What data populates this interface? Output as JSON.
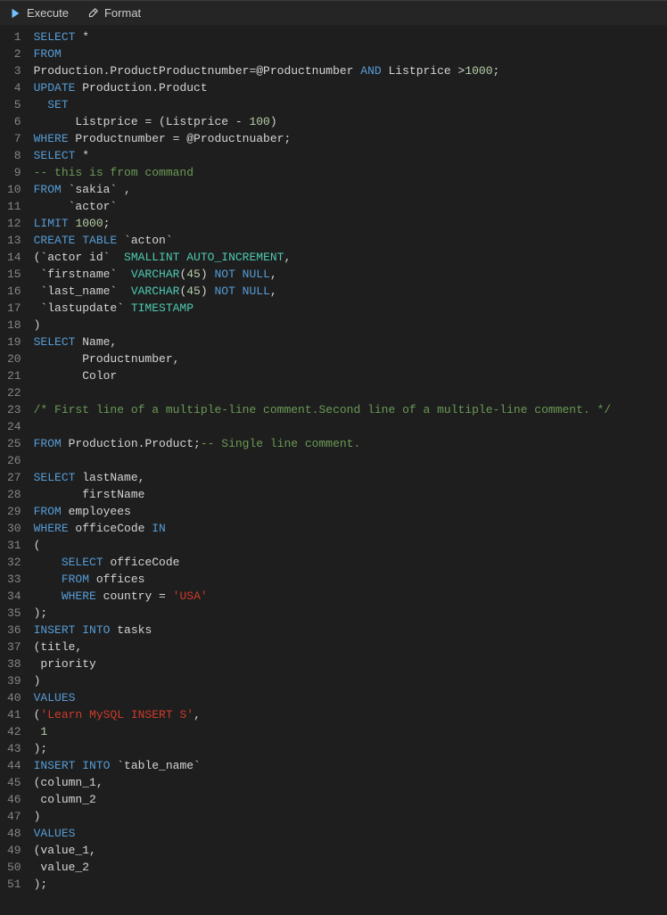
{
  "toolbar": {
    "execute_label": "Execute",
    "format_label": "Format"
  },
  "code": {
    "lines": [
      [
        {
          "c": "kw",
          "t": "SELECT"
        },
        {
          "c": "id",
          "t": " *"
        }
      ],
      [
        {
          "c": "kw",
          "t": "FROM"
        }
      ],
      [
        {
          "c": "id",
          "t": "Production.ProductProductnumber=@Productnumber "
        },
        {
          "c": "kw",
          "t": "AND"
        },
        {
          "c": "id",
          "t": " Listprice >"
        },
        {
          "c": "num",
          "t": "1000"
        },
        {
          "c": "punc",
          "t": ";"
        }
      ],
      [
        {
          "c": "kw",
          "t": "UPDATE"
        },
        {
          "c": "id",
          "t": " Production.Product"
        }
      ],
      [
        {
          "c": "id",
          "t": "  "
        },
        {
          "c": "kw",
          "t": "SET"
        }
      ],
      [
        {
          "c": "id",
          "t": "      Listprice = (Listprice - "
        },
        {
          "c": "num",
          "t": "100"
        },
        {
          "c": "punc",
          "t": ")"
        }
      ],
      [
        {
          "c": "kw",
          "t": "WHERE"
        },
        {
          "c": "id",
          "t": " Productnumber = @Productnuaber;"
        }
      ],
      [
        {
          "c": "kw",
          "t": "SELECT"
        },
        {
          "c": "id",
          "t": " *"
        }
      ],
      [
        {
          "c": "cmt",
          "t": "-- this is from command"
        }
      ],
      [
        {
          "c": "kw",
          "t": "FROM"
        },
        {
          "c": "id",
          "t": " `sakia` ,"
        }
      ],
      [
        {
          "c": "id",
          "t": "     `actor`"
        }
      ],
      [
        {
          "c": "kw",
          "t": "LIMIT"
        },
        {
          "c": "id",
          "t": " "
        },
        {
          "c": "num",
          "t": "1000"
        },
        {
          "c": "punc",
          "t": ";"
        }
      ],
      [
        {
          "c": "kw",
          "t": "CREATE TABLE"
        },
        {
          "c": "id",
          "t": " `acton`"
        }
      ],
      [
        {
          "c": "punc",
          "t": "("
        },
        {
          "c": "id",
          "t": "`actor id`  "
        },
        {
          "c": "type",
          "t": "SMALLINT AUTO_INCREMENT"
        },
        {
          "c": "punc",
          "t": ","
        }
      ],
      [
        {
          "c": "id",
          "t": " `firstname`  "
        },
        {
          "c": "type",
          "t": "VARCHAR"
        },
        {
          "c": "punc",
          "t": "("
        },
        {
          "c": "num",
          "t": "45"
        },
        {
          "c": "punc",
          "t": ") "
        },
        {
          "c": "kw",
          "t": "NOT NULL"
        },
        {
          "c": "punc",
          "t": ","
        }
      ],
      [
        {
          "c": "id",
          "t": " `last_name`  "
        },
        {
          "c": "type",
          "t": "VARCHAR"
        },
        {
          "c": "punc",
          "t": "("
        },
        {
          "c": "num",
          "t": "45"
        },
        {
          "c": "punc",
          "t": ") "
        },
        {
          "c": "kw",
          "t": "NOT NULL"
        },
        {
          "c": "punc",
          "t": ","
        }
      ],
      [
        {
          "c": "id",
          "t": " `lastupdate` "
        },
        {
          "c": "type",
          "t": "TIMESTAMP"
        }
      ],
      [
        {
          "c": "punc",
          "t": ")"
        }
      ],
      [
        {
          "c": "kw",
          "t": "SELECT"
        },
        {
          "c": "id",
          "t": " Name,"
        }
      ],
      [
        {
          "c": "id",
          "t": "       Productnumber,"
        }
      ],
      [
        {
          "c": "id",
          "t": "       Color"
        }
      ],
      [
        {
          "c": "id",
          "t": ""
        }
      ],
      [
        {
          "c": "cmt",
          "t": "/* First line of a multiple-line comment.Second line of a multiple-line comment. */"
        }
      ],
      [
        {
          "c": "id",
          "t": ""
        }
      ],
      [
        {
          "c": "kw",
          "t": "FROM"
        },
        {
          "c": "id",
          "t": " Production.Product;"
        },
        {
          "c": "cmt",
          "t": "-- Single line comment."
        }
      ],
      [
        {
          "c": "id",
          "t": ""
        }
      ],
      [
        {
          "c": "kw",
          "t": "SELECT"
        },
        {
          "c": "id",
          "t": " lastName,"
        }
      ],
      [
        {
          "c": "id",
          "t": "       firstName"
        }
      ],
      [
        {
          "c": "kw",
          "t": "FROM"
        },
        {
          "c": "id",
          "t": " employees"
        }
      ],
      [
        {
          "c": "kw",
          "t": "WHERE"
        },
        {
          "c": "id",
          "t": " officeCode "
        },
        {
          "c": "kw",
          "t": "IN"
        }
      ],
      [
        {
          "c": "punc",
          "t": "("
        }
      ],
      [
        {
          "c": "id",
          "t": "    "
        },
        {
          "c": "kw",
          "t": "SELECT"
        },
        {
          "c": "id",
          "t": " officeCode"
        }
      ],
      [
        {
          "c": "id",
          "t": "    "
        },
        {
          "c": "kw",
          "t": "FROM"
        },
        {
          "c": "id",
          "t": " offices"
        }
      ],
      [
        {
          "c": "id",
          "t": "    "
        },
        {
          "c": "kw",
          "t": "WHERE"
        },
        {
          "c": "id",
          "t": " country = "
        },
        {
          "c": "str",
          "t": "'USA'"
        }
      ],
      [
        {
          "c": "punc",
          "t": ");"
        }
      ],
      [
        {
          "c": "kw",
          "t": "INSERT INTO"
        },
        {
          "c": "id",
          "t": " tasks"
        }
      ],
      [
        {
          "c": "punc",
          "t": "("
        },
        {
          "c": "id",
          "t": "title,"
        }
      ],
      [
        {
          "c": "id",
          "t": " priority"
        }
      ],
      [
        {
          "c": "punc",
          "t": ")"
        }
      ],
      [
        {
          "c": "kw",
          "t": "VALUES"
        }
      ],
      [
        {
          "c": "punc",
          "t": "("
        },
        {
          "c": "str",
          "t": "'Learn MySQL INSERT S'"
        },
        {
          "c": "punc",
          "t": ","
        }
      ],
      [
        {
          "c": "id",
          "t": " "
        },
        {
          "c": "num",
          "t": "1"
        }
      ],
      [
        {
          "c": "punc",
          "t": ");"
        }
      ],
      [
        {
          "c": "kw",
          "t": "INSERT INTO"
        },
        {
          "c": "id",
          "t": " `table_name`"
        }
      ],
      [
        {
          "c": "punc",
          "t": "("
        },
        {
          "c": "id",
          "t": "column_1,"
        }
      ],
      [
        {
          "c": "id",
          "t": " column_2"
        }
      ],
      [
        {
          "c": "punc",
          "t": ")"
        }
      ],
      [
        {
          "c": "kw",
          "t": "VALUES"
        }
      ],
      [
        {
          "c": "punc",
          "t": "("
        },
        {
          "c": "id",
          "t": "value_1,"
        }
      ],
      [
        {
          "c": "id",
          "t": " value_2"
        }
      ],
      [
        {
          "c": "punc",
          "t": ");"
        }
      ]
    ]
  }
}
